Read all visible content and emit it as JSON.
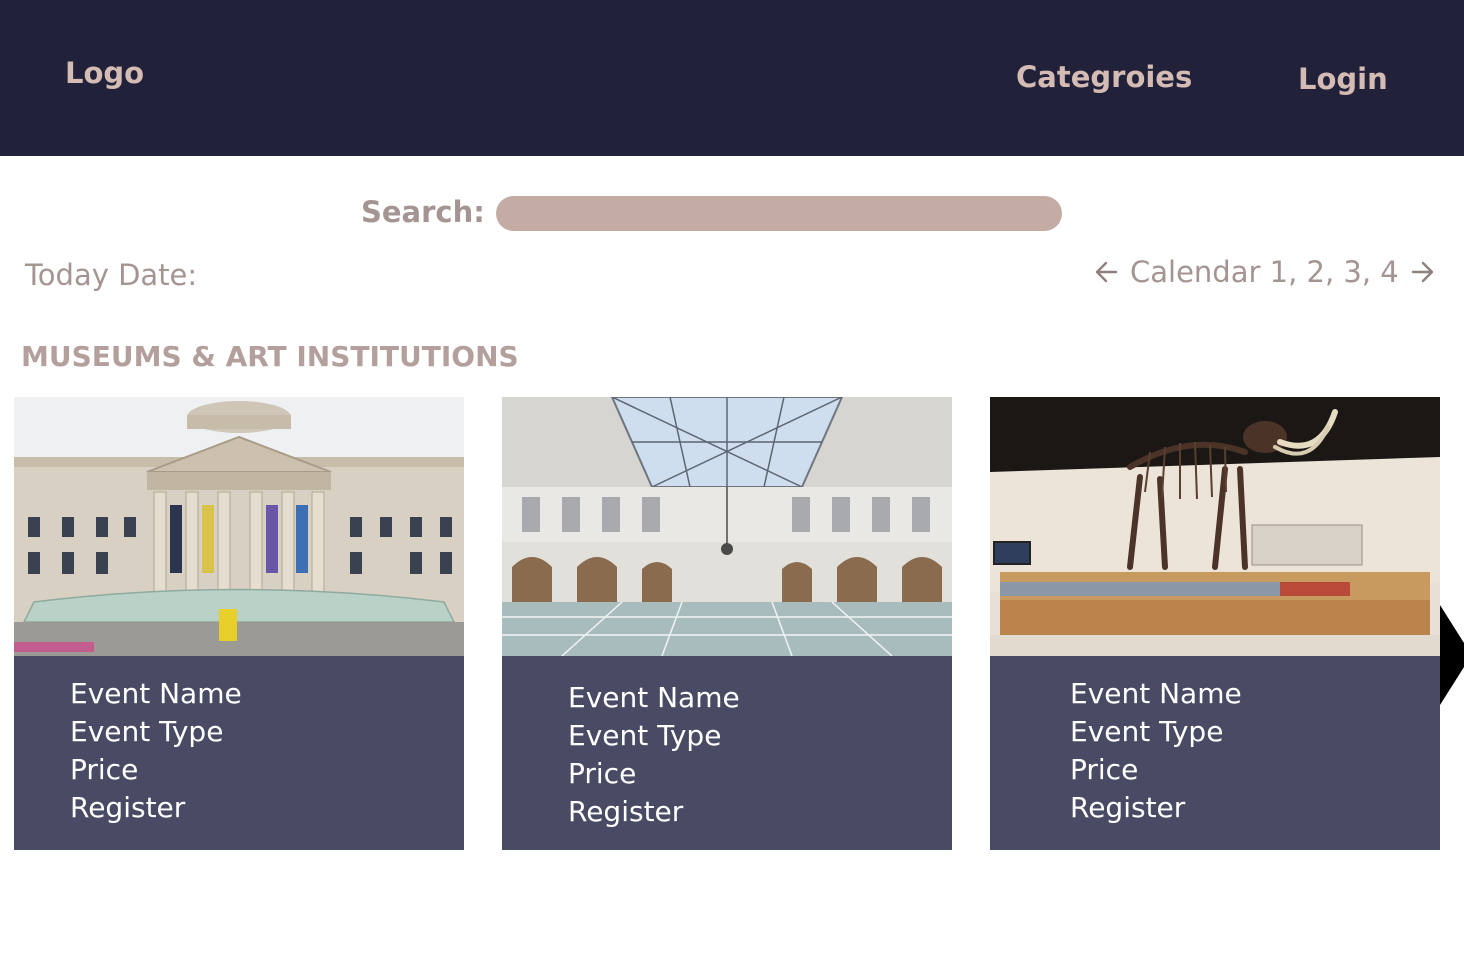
{
  "header": {
    "logo": "Logo",
    "nav_categories": "Categroies",
    "nav_login": "Login"
  },
  "search": {
    "label": "Search:",
    "value": ""
  },
  "today_date_label": "Today Date:",
  "calendar": {
    "text": "Calendar 1, 2, 3, 4",
    "left_icon": "arrow-left-icon",
    "right_icon": "arrow-right-icon"
  },
  "section_title": "MUSEUMS & ART INSTITUTIONS",
  "cards": [
    {
      "image": "museum-exterior-photo",
      "event_name": "Event Name",
      "event_type": "Event Type",
      "price": "Price",
      "register": "Register"
    },
    {
      "image": "museum-atrium-photo",
      "event_name": "Event Name",
      "event_type": "Event Type",
      "price": "Price",
      "register": "Register"
    },
    {
      "image": "mastodon-skeleton-photo",
      "event_name": "Event Name",
      "event_type": "Event Type",
      "price": "Price",
      "register": "Register"
    }
  ],
  "colors": {
    "header_bg": "#22213a",
    "accent_text": "#d4bcb4",
    "muted_text": "#a59592",
    "search_bg": "#c4aca5",
    "card_body_bg": "#494b64"
  },
  "carousel_next_icon": "carousel-next-icon"
}
